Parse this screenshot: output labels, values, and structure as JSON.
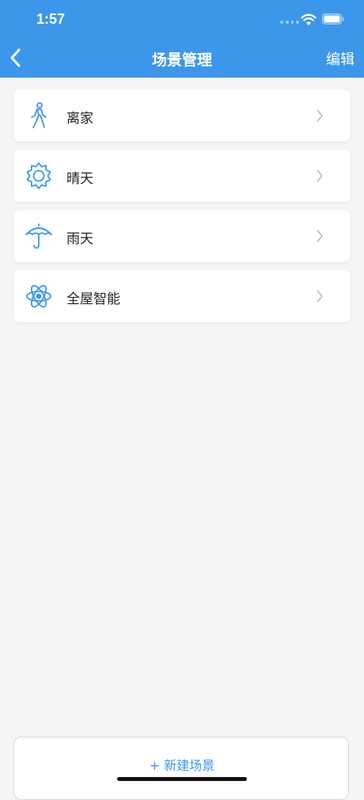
{
  "status_bar": {
    "time": "1:57"
  },
  "nav": {
    "title": "场景管理",
    "edit_label": "编辑"
  },
  "scenes": [
    {
      "label": "离家",
      "icon": "walking-person-icon"
    },
    {
      "label": "晴天",
      "icon": "sun-icon"
    },
    {
      "label": "雨天",
      "icon": "umbrella-icon"
    },
    {
      "label": "全屋智能",
      "icon": "atom-icon"
    }
  ],
  "actions": {
    "new_scene_label": "+ 新建场景"
  },
  "colors": {
    "accent": "#3c97ea",
    "background": "#f5f5f5",
    "card": "#ffffff",
    "text": "#222222",
    "chevron": "#b5b5b5"
  }
}
